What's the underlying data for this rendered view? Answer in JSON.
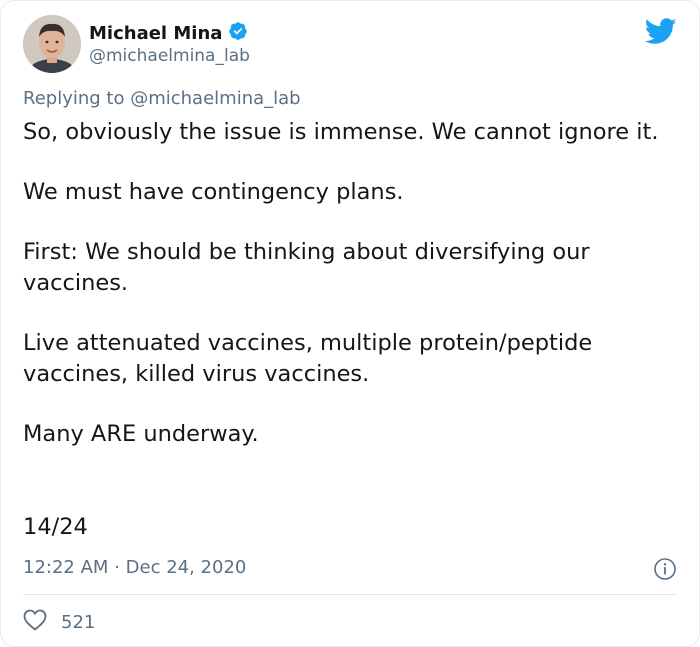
{
  "author": {
    "name": "Michael Mina",
    "handle": "@michaelmina_lab",
    "verified": true
  },
  "reply": {
    "prefix": "Replying to",
    "mention": "@michaelmina_lab"
  },
  "tweet": {
    "paragraphs": [
      "So, obviously the issue is immense. We cannot ignore it.",
      "We must have contingency plans.",
      "First: We should be thinking about diversifying our vaccines.",
      "Live attenuated vaccines, multiple protein/peptide vaccines, killed virus vaccines.",
      "Many ARE underway."
    ],
    "counter": "14/24"
  },
  "meta": {
    "time": "12:22 AM",
    "separator": "·",
    "date": "Dec 24, 2020"
  },
  "stats": {
    "likes": "521"
  },
  "colors": {
    "twitter_blue": "#1da1f2",
    "secondary_text": "#5b7083",
    "primary_text": "#14171a"
  },
  "icons": {
    "bird": "twitter-bird-icon",
    "verified": "verified-badge-icon",
    "info": "info-icon",
    "like": "heart-icon"
  }
}
